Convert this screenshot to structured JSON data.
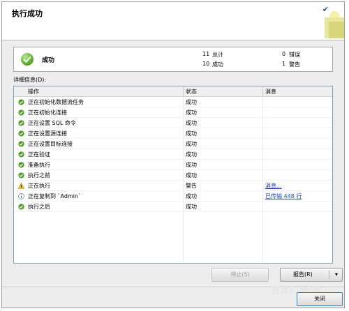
{
  "dialog": {
    "title": "执行成功"
  },
  "summary": {
    "status": "成功",
    "total_value": "11",
    "total_label": "总计",
    "success_value": "10",
    "success_label": "成功",
    "error_value": "0",
    "error_label": "错误",
    "warning_value": "1",
    "warning_label": "警告"
  },
  "details": {
    "label": "详细信息(D):",
    "columns": [
      "操作",
      "状态",
      "消息"
    ],
    "rows": [
      {
        "icon": "success-icon",
        "action": "正在初始化数据流任务",
        "status": "成功",
        "message": ""
      },
      {
        "icon": "success-icon",
        "action": "正在初始化连接",
        "status": "成功",
        "message": ""
      },
      {
        "icon": "success-icon",
        "action": "正在设置 SQL 命令",
        "status": "成功",
        "message": ""
      },
      {
        "icon": "success-icon",
        "action": "正在设置源连接",
        "status": "成功",
        "message": ""
      },
      {
        "icon": "success-icon",
        "action": "正在设置目标连接",
        "status": "成功",
        "message": ""
      },
      {
        "icon": "success-icon",
        "action": "正在验证",
        "status": "成功",
        "message": ""
      },
      {
        "icon": "success-icon",
        "action": "准备执行",
        "status": "成功",
        "message": ""
      },
      {
        "icon": "success-icon",
        "action": "执行之前",
        "status": "成功",
        "message": ""
      },
      {
        "icon": "warning-icon",
        "action": "正在执行",
        "status": "警告",
        "message": "消息..."
      },
      {
        "icon": "info-icon",
        "action": "正在复制到 `Admin`",
        "status": "成功",
        "message": "已传输 448 行"
      },
      {
        "icon": "success-icon",
        "action": "执行之后",
        "status": "成功",
        "message": ""
      }
    ]
  },
  "buttons": {
    "stop": "停止(S)",
    "report": "报告(R)",
    "close": "关闭"
  },
  "watermark": "Bai 经验",
  "colors": {
    "success": "#4e9e26",
    "warning": "#e0a800",
    "link": "#1a3fb0"
  }
}
